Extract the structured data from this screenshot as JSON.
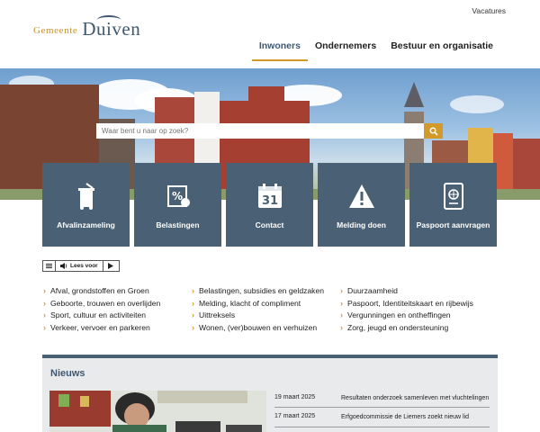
{
  "header": {
    "util_link": "Vacatures",
    "logo_small": "Gemeente",
    "logo_big": "Duiven",
    "nav": [
      {
        "label": "Inwoners",
        "active": true
      },
      {
        "label": "Ondernemers",
        "active": false
      },
      {
        "label": "Bestuur en organisatie",
        "active": false
      }
    ]
  },
  "search": {
    "placeholder": "Waar bent u naar op zoek?"
  },
  "tiles": [
    {
      "label": "Afvalinzameling",
      "icon": "waste-container-icon"
    },
    {
      "label": "Belastingen",
      "icon": "tax-document-icon"
    },
    {
      "label": "Contact",
      "icon": "calendar-icon",
      "icon_text": "31"
    },
    {
      "label": "Melding doen",
      "icon": "warning-icon"
    },
    {
      "label": "Paspoort aanvragen",
      "icon": "passport-icon"
    }
  ],
  "readspeaker": {
    "label": "Lees voor"
  },
  "links": {
    "col1": [
      "Afval, grondstoffen en Groen",
      "Geboorte, trouwen en overlijden",
      "Sport, cultuur en activiteiten",
      "Verkeer, vervoer en parkeren"
    ],
    "col2": [
      "Belastingen, subsidies en geldzaken",
      "Melding, klacht of compliment",
      "Uittreksels",
      "Wonen, (ver)bouwen en verhuizen"
    ],
    "col3": [
      "Duurzaamheid",
      "Paspoort, Identiteitskaart en rijbewijs",
      "Vergunningen en ontheffingen",
      "Zorg, jeugd en ondersteuning"
    ]
  },
  "news": {
    "title": "Nieuws",
    "items": [
      {
        "date": "19 maart 2025",
        "text": "Resultaten onderzoek samenleven met vluchtelingen"
      },
      {
        "date": "17 maart 2025",
        "text": "Erfgoedcommissie de Liemers zoekt nieuw lid"
      }
    ]
  },
  "colors": {
    "accent": "#d19a2b",
    "brand": "#3f5872",
    "tile": "#4a6074"
  }
}
